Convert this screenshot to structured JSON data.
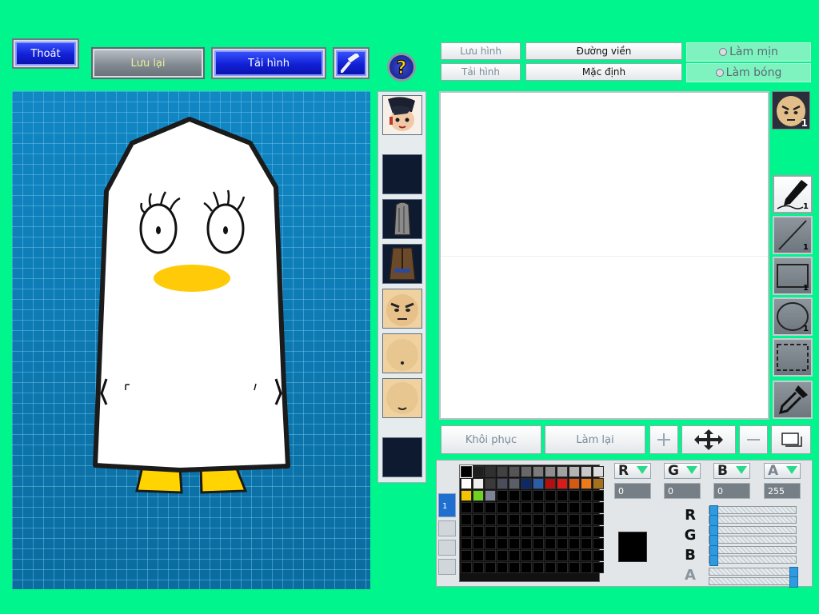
{
  "top_left": {
    "exit_label": "Thoát",
    "save_label": "Lưu lại",
    "reload_label": "Tải hình"
  },
  "right_top": {
    "save_image": "Lưu hình",
    "reload_image": "Tải hình",
    "outline": "Đường viền",
    "default": "Mặc định",
    "smooth": "Làm mịn",
    "shine": "Làm bóng"
  },
  "edit_bar": {
    "restore": "Khôi phục",
    "redo": "Làm lại"
  },
  "tools": {
    "pen_count": "1",
    "line_count": "1",
    "rect_count": "1",
    "ellipse_count": "1",
    "face_badge": "1"
  },
  "color": {
    "channels": [
      "R",
      "G",
      "B",
      "A"
    ],
    "r": "0",
    "g": "0",
    "b": "0",
    "a": "255",
    "current": "#000000",
    "palette": [
      "#000000",
      "#1e1e1e",
      "#303030",
      "#424242",
      "#555555",
      "#686868",
      "#7b7b7b",
      "#8e8e8e",
      "#a1a1a1",
      "#b4b4b4",
      "#c8c8c8",
      "#dcdcdc",
      "#ffffff",
      "#eeeeee",
      "#3a3a3a",
      "#4a4e5a",
      "#5a5e68",
      "#0e2a66",
      "#2b5ea8",
      "#b01010",
      "#d81c1c",
      "#d25a12",
      "#ef7a1a",
      "#a6701c",
      "#f5c400",
      "#6fd21e",
      "#7d8294"
    ],
    "layer_tab": "1"
  }
}
